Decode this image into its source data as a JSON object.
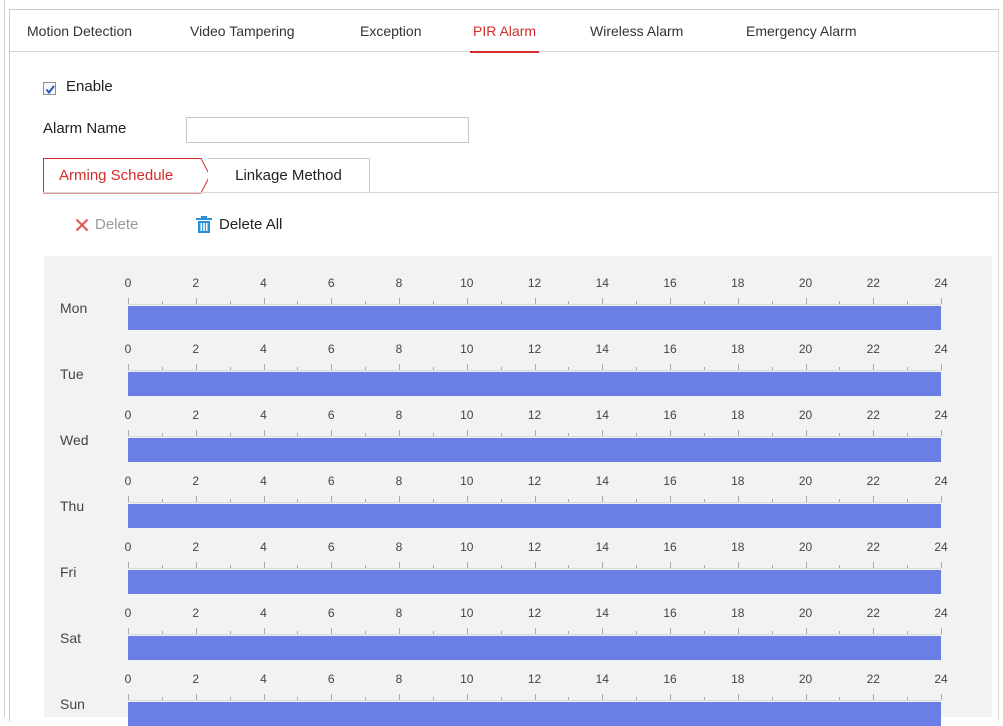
{
  "tabs": [
    {
      "label": "Motion Detection",
      "active": false
    },
    {
      "label": "Video Tampering",
      "active": false
    },
    {
      "label": "Exception",
      "active": false
    },
    {
      "label": "PIR Alarm",
      "active": true
    },
    {
      "label": "Wireless Alarm",
      "active": false
    },
    {
      "label": "Emergency Alarm",
      "active": false
    }
  ],
  "enable": {
    "label": "Enable",
    "checked": true
  },
  "alarm_name": {
    "label": "Alarm Name",
    "value": "",
    "placeholder": ""
  },
  "subtabs": {
    "arming": "Arming Schedule",
    "linkage": "Linkage Method"
  },
  "toolbar": {
    "delete_label": "Delete",
    "delete_all_label": "Delete All"
  },
  "schedule": {
    "ticks": [
      "0",
      "2",
      "4",
      "6",
      "8",
      "10",
      "12",
      "14",
      "16",
      "18",
      "20",
      "22",
      "24"
    ],
    "days": [
      {
        "label": "Mon",
        "start": 0,
        "end": 24
      },
      {
        "label": "Tue",
        "start": 0,
        "end": 24
      },
      {
        "label": "Wed",
        "start": 0,
        "end": 24
      },
      {
        "label": "Thu",
        "start": 0,
        "end": 24
      },
      {
        "label": "Fri",
        "start": 0,
        "end": 24
      },
      {
        "label": "Sat",
        "start": 0,
        "end": 24
      },
      {
        "label": "Sun",
        "start": 0,
        "end": 24
      }
    ]
  },
  "colors": {
    "accent": "#d22b2b",
    "schedule_bar": "#6a7fe6",
    "panel_bg": "#f2f2f2",
    "delete_all_icon": "#2a8fd6"
  }
}
